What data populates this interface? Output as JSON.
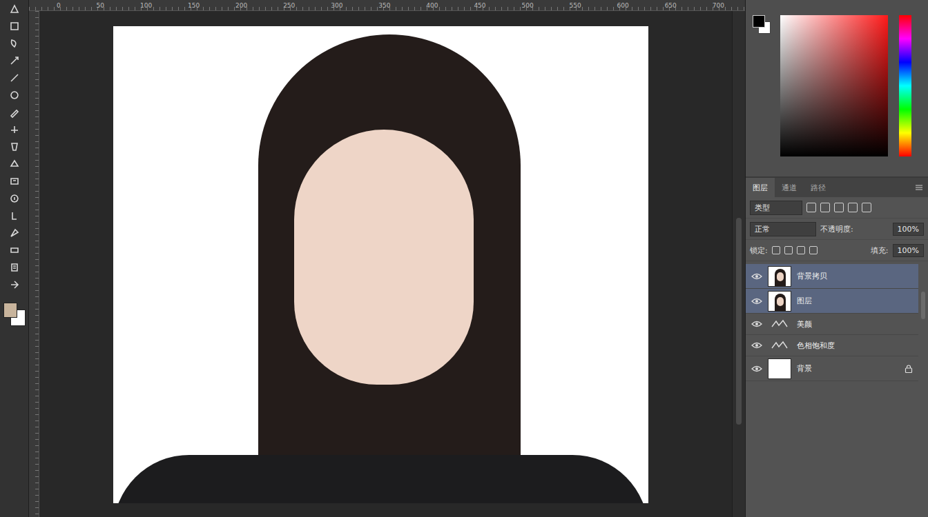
{
  "ruler": {
    "marks": [
      "0",
      "50",
      "100",
      "150",
      "200",
      "250",
      "300",
      "350",
      "400",
      "450",
      "500",
      "550",
      "600",
      "650",
      "700"
    ]
  },
  "layers_panel": {
    "tabs": [
      {
        "label": "图层",
        "selected": true
      },
      {
        "label": "通道",
        "selected": false
      },
      {
        "label": "路径",
        "selected": false
      }
    ],
    "filter": "类型",
    "blend_mode": "正常",
    "opacity_label": "不透明度:",
    "opacity": "100%",
    "lock_label": "锁定:",
    "fill_label": "填充:",
    "fill": "100%",
    "layers": [
      {
        "name": "背景拷贝",
        "kind": "photo",
        "visible": true,
        "selected": true,
        "locked": false
      },
      {
        "name": "图层",
        "kind": "photo",
        "visible": true,
        "selected": true,
        "locked": false
      },
      {
        "name": "美颜",
        "kind": "adjustment",
        "visible": true,
        "selected": false,
        "locked": false
      },
      {
        "name": "色相饱和度",
        "kind": "adjustment",
        "visible": true,
        "selected": false,
        "locked": false
      },
      {
        "name": "背景",
        "kind": "fill",
        "visible": true,
        "selected": false,
        "locked": true
      }
    ]
  }
}
